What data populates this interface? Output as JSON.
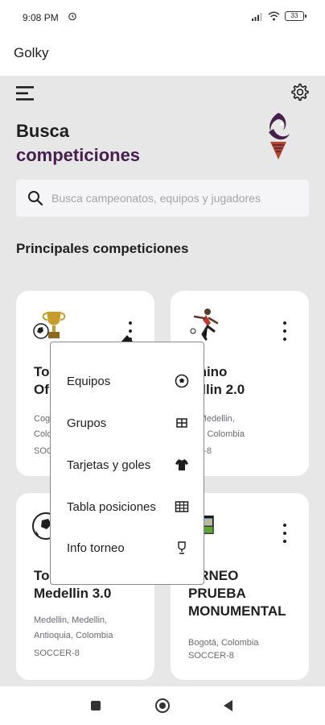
{
  "status_bar": {
    "time": "9:08 PM",
    "battery": "33"
  },
  "app": {
    "title": "Golky"
  },
  "hero": {
    "line1": "Busca",
    "line2": "competiciones"
  },
  "search": {
    "placeholder": "Busca campeonatos, equipos y jugadores"
  },
  "section": {
    "title": "Principales competiciones"
  },
  "cards": [
    {
      "name": "To\nOf",
      "location": "Cog\nColo",
      "type": "SOCCER-8",
      "image": "trophy-ball-icon"
    },
    {
      "name": "menino\nedellin 2.0",
      "location": "ellin, Medellin,\nioquia, Colombia",
      "type": "CCER-8",
      "image": "soccer-player-icon"
    },
    {
      "name": "To\nMedellin 3.0",
      "location": "Medellin, Medellin,\nAntioquia, Colombia",
      "type": "SOCCER-8",
      "image": "soccer-ball-icon"
    },
    {
      "name": "ORNEO\nPRUEBA\nMONUMENTAL",
      "location": "Bogotá, Colombia",
      "type": "SOCCER-8",
      "image": "stadium-icon"
    }
  ],
  "popup_menu": {
    "items": [
      {
        "label": "Equipos",
        "icon": "soccer-ball-icon"
      },
      {
        "label": "Grupos",
        "icon": "grid-icon"
      },
      {
        "label": "Tarjetas y goles",
        "icon": "jersey-icon"
      },
      {
        "label": "Tabla posiciones",
        "icon": "table-icon"
      },
      {
        "label": "Info torneo",
        "icon": "trophy-icon"
      }
    ]
  },
  "colors": {
    "accent": "#45204d",
    "background": "#e7e7e7",
    "card": "#ffffff"
  }
}
